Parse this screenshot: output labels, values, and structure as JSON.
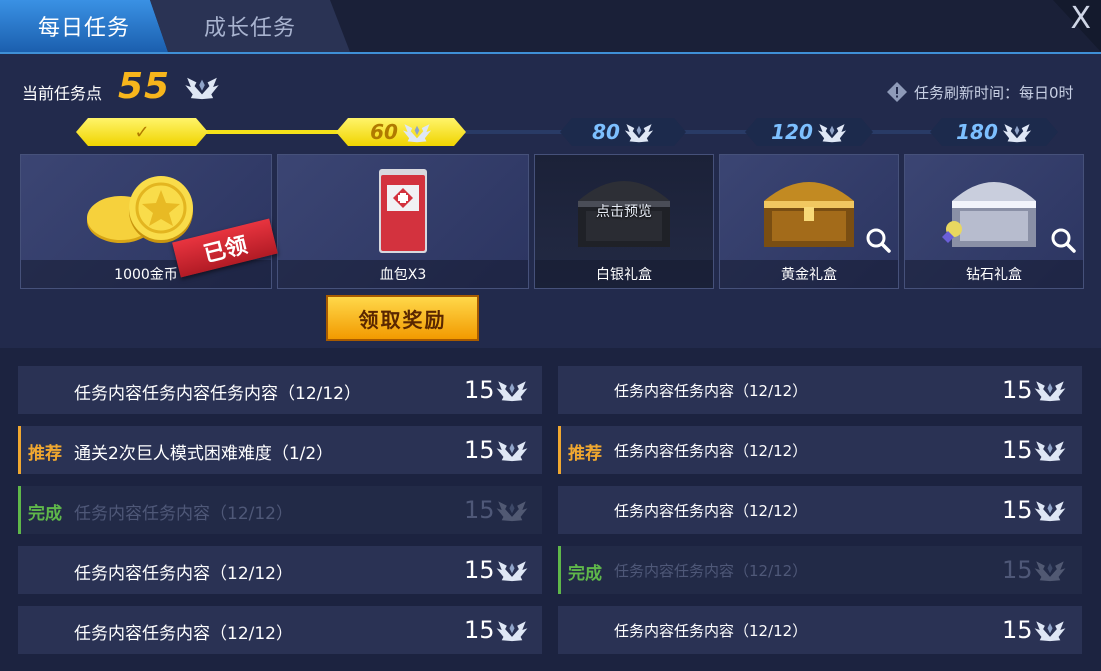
{
  "tabs": [
    "每日任务",
    "成长任务"
  ],
  "close_label": "X",
  "points": {
    "label": "当前任务点",
    "value": "55"
  },
  "refresh_text": "任务刷新时间：每日0时",
  "milestones": [
    {
      "label": "✓",
      "state": "claimed"
    },
    {
      "label": "60",
      "state": "reached"
    },
    {
      "label": "80",
      "state": "locked"
    },
    {
      "label": "120",
      "state": "locked"
    },
    {
      "label": "180",
      "state": "locked"
    }
  ],
  "rewards": [
    {
      "name": "1000金币",
      "badge": "已领"
    },
    {
      "name": "血包X3"
    },
    {
      "name": "白银礼盒",
      "overlay": "点击预览"
    },
    {
      "name": "黄金礼盒"
    },
    {
      "name": "钻石礼盒"
    }
  ],
  "claim_button": "领取奖励",
  "tasks_left": [
    {
      "tag": "",
      "text": "任务内容任务内容任务内容（12/12）",
      "value": "15",
      "state": "normal"
    },
    {
      "tag": "推荐",
      "text": "通关2次巨人模式困难难度（1/2）",
      "value": "15",
      "state": "recommended"
    },
    {
      "tag": "完成",
      "text": "任务内容任务内容（12/12）",
      "value": "15",
      "state": "done"
    },
    {
      "tag": "",
      "text": "任务内容任务内容（12/12）",
      "value": "15",
      "state": "normal"
    },
    {
      "tag": "",
      "text": "任务内容任务内容（12/12）",
      "value": "15",
      "state": "normal"
    }
  ],
  "tasks_right": [
    {
      "tag": "",
      "text": "任务内容任务内容（12/12）",
      "value": "15",
      "state": "normal"
    },
    {
      "tag": "推荐",
      "text": "任务内容任务内容（12/12）",
      "value": "15",
      "state": "recommended"
    },
    {
      "tag": "",
      "text": "任务内容任务内容（12/12）",
      "value": "15",
      "state": "normal"
    },
    {
      "tag": "完成",
      "text": "任务内容任务内容（12/12）",
      "value": "15",
      "state": "done"
    },
    {
      "tag": "",
      "text": "任务内容任务内容（12/12）",
      "value": "15",
      "state": "normal"
    }
  ],
  "colors": {
    "accent": "#3a91e4",
    "gold": "#f7b51c",
    "recommended": "#f0a830",
    "done": "#5fb84a"
  }
}
